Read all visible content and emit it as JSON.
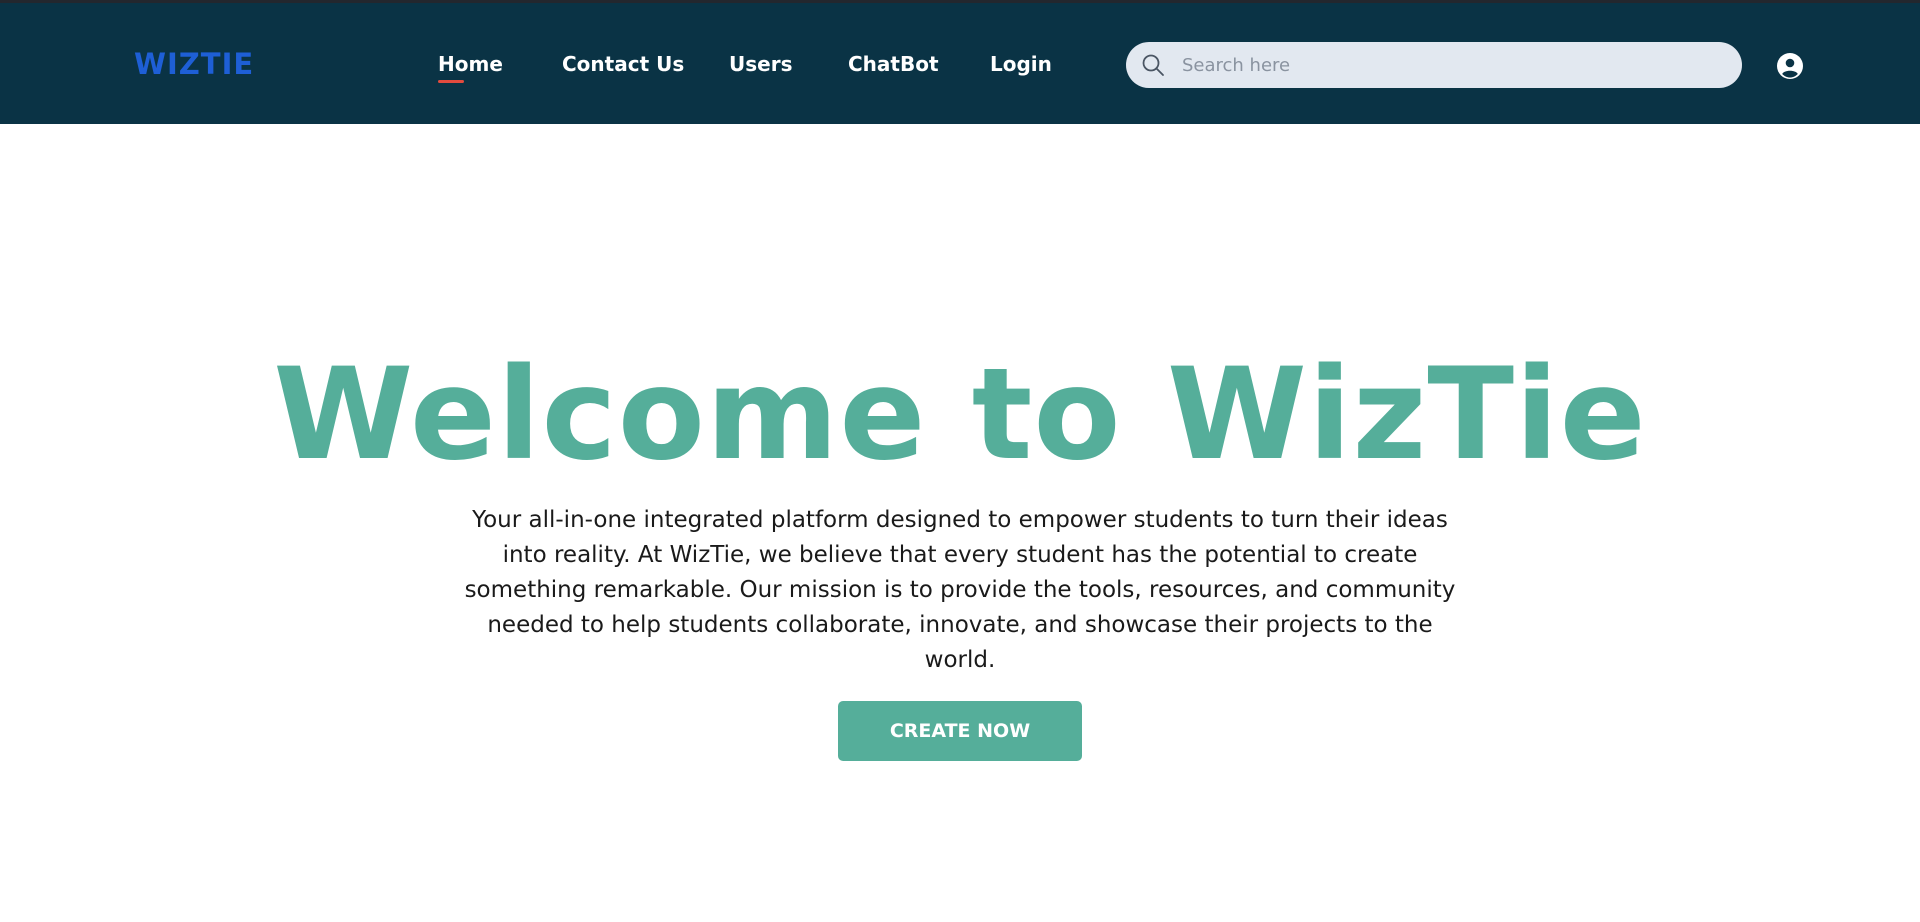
{
  "header": {
    "logo": "WIZTIE",
    "nav": {
      "home": "Home",
      "contact": "Contact Us",
      "users": "Users",
      "chatbot": "ChatBot",
      "login": "Login"
    },
    "active_tab": "Home",
    "search": {
      "placeholder": "Search here",
      "value": ""
    },
    "icons": {
      "search": "search-icon",
      "user": "user-icon"
    }
  },
  "hero": {
    "title": "Welcome to WizTie",
    "description": "Your all-in-one integrated platform designed to empower students to turn their ideas into reality. At WizTie, we believe that every student has the potential to create something remarkable. Our mission is to provide the tools, resources, and community needed to help students collaborate, innovate, and showcase their projects to the world.",
    "cta_label": "CREATE NOW"
  },
  "colors": {
    "navbar_bg": "#0a3345",
    "logo": "#1e5fd6",
    "accent": "#55ae9a",
    "active_underline": "#e34b3e",
    "search_bg": "#e2e8f0"
  }
}
